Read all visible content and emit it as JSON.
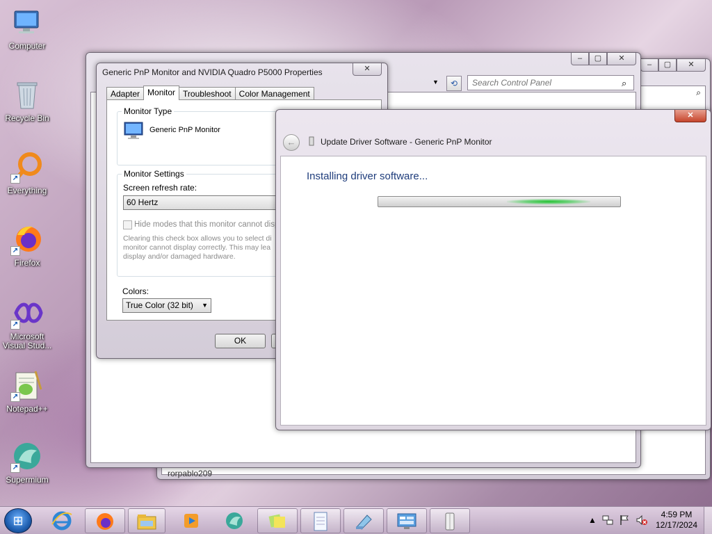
{
  "desktop": {
    "icons": [
      {
        "label": "Computer",
        "icon": "computer-icon"
      },
      {
        "label": "Recycle Bin",
        "icon": "recycle-bin-icon"
      },
      {
        "label": "Everything",
        "icon": "everything-icon"
      },
      {
        "label": "Firefox",
        "icon": "firefox-icon"
      },
      {
        "label": "Microsoft Visual Stud...",
        "icon": "visual-studio-icon"
      },
      {
        "label": "Notepad++",
        "icon": "notepadpp-icon"
      },
      {
        "label": "Supermium",
        "icon": "supermium-icon"
      }
    ],
    "background_fragment": "rorpablo209"
  },
  "control_panel": {
    "search_placeholder": "Search Control Panel"
  },
  "monitor_props": {
    "title": "Generic PnP Monitor and NVIDIA Quadro P5000 Properties",
    "tabs": [
      "Adapter",
      "Monitor",
      "Troubleshoot",
      "Color Management"
    ],
    "active_tab": "Monitor",
    "monitor_type_title": "Monitor Type",
    "monitor_name": "Generic PnP Monitor",
    "settings_title": "Monitor Settings",
    "refresh_label": "Screen refresh rate:",
    "refresh_value": "60 Hertz",
    "hide_modes_label": "Hide modes that this monitor cannot displa",
    "hide_modes_checked": false,
    "warning_lines": [
      "Clearing this check box allows you to select di",
      "monitor cannot display correctly. This may lea",
      "display and/or damaged hardware."
    ],
    "colors_label": "Colors:",
    "colors_value": "True Color (32 bit)",
    "ok_label": "OK"
  },
  "update_driver": {
    "title": "Update Driver Software - Generic PnP Monitor",
    "heading": "Installing driver software...",
    "progress_mode": "indeterminate"
  },
  "taskbar": {
    "apps": [
      "ie-icon",
      "firefox-icon",
      "explorer-icon",
      "media-player-icon",
      "supermium-icon",
      "sticky-notes-icon",
      "notepad-icon",
      "paint-icon",
      "control-panel-icon",
      "device-icon"
    ],
    "time": "4:59 PM",
    "date": "12/17/2024"
  }
}
